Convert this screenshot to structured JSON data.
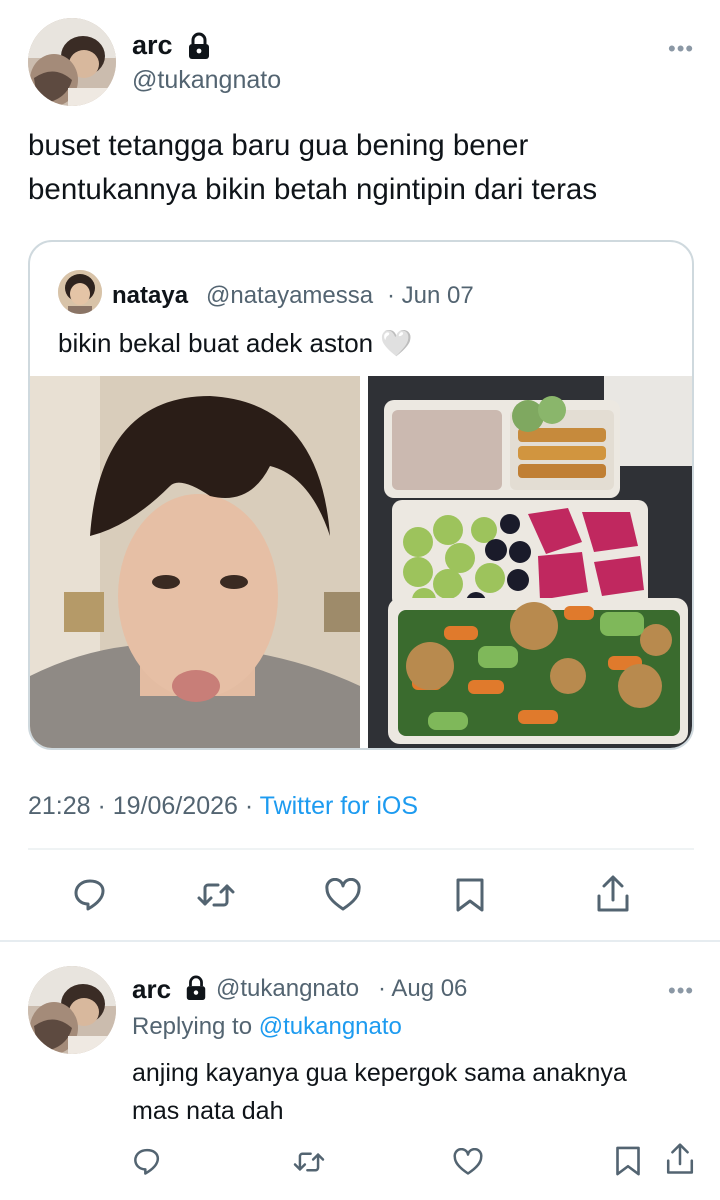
{
  "main_tweet": {
    "author_name": "arc",
    "author_handle": "@tukangnato",
    "more_glyph": "•••",
    "text_line1": "buset tetangga baru gua bening bener",
    "text_line2": "bentukannya bikin betah ngintipin dari teras",
    "timestamp": "21:28 · 19/06/2026 · ",
    "source": "Twitter for iOS"
  },
  "quoted_tweet": {
    "author_name": "nataya",
    "author_handle": "@natayamessa",
    "date": "· Jun 07",
    "text": "bikin bekal buat adek aston 🤍"
  },
  "actions": [
    "reply-icon",
    "retweet-icon",
    "like-icon",
    "bookmark-icon",
    "share-icon"
  ],
  "reply_tweet": {
    "author_name": "arc",
    "author_handle": "@tukangnato",
    "date": "· Aug 06",
    "more_glyph": "•••",
    "replying_prefix": "Replying to ",
    "replying_to": "@tukangnato",
    "text_line1": "anjing kayanya gua kepergok sama anaknya",
    "text_line2": "mas nata dah"
  },
  "colors": {
    "accent": "#1d9bf0",
    "secondary_text": "#536471",
    "border": "#cfd9de"
  }
}
